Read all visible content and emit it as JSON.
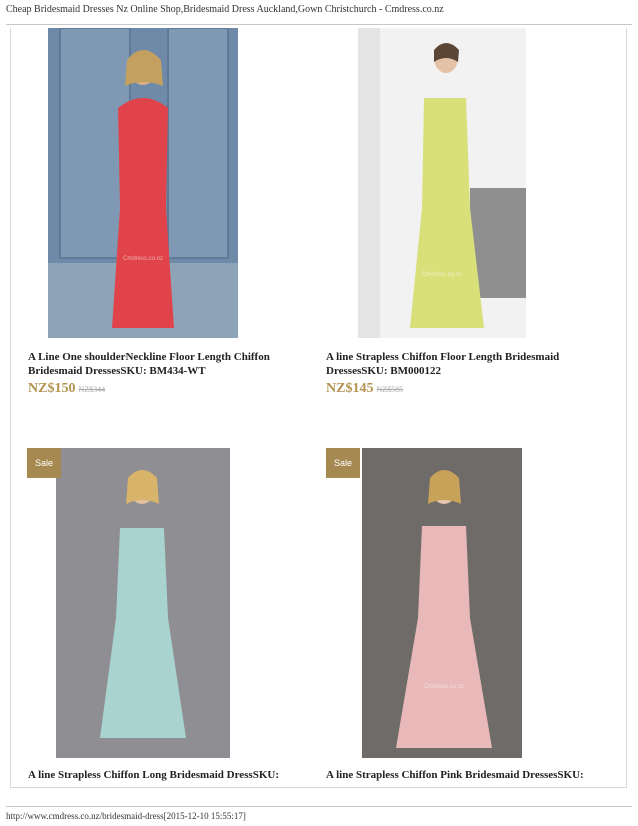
{
  "header": {
    "title": "Cheap Bridesmaid Dresses Nz Online Shop,Bridesmaid Dress Auckland,Gown Christchurch - Cmdress.co.nz"
  },
  "products": [
    {
      "title": "A Line One shoulderNeckline Floor Length Chiffon Bridesmaid DressesSKU: BM434-WT",
      "price": "NZ$150",
      "old_price": "NZ$344",
      "dress_color": "#e0444a",
      "watermark": "Cmdress.co.nz"
    },
    {
      "title": "A line Strapless Chiffon Floor Length Bridesmaid DressesSKU: BM000122",
      "price": "NZ$145",
      "old_price": "NZ$585",
      "dress_color": "#d9e07a",
      "watermark": "Cmdress.co.nz"
    },
    {
      "title": "A line Strapless Chiffon Long Bridesmaid DressSKU:",
      "sale_badge": "Sale",
      "dress_color": "#a9d3cf"
    },
    {
      "title": "A line Strapless Chiffon Pink Bridesmaid DressesSKU:",
      "sale_badge": "Sale",
      "dress_color": "#e8b9b8",
      "watermark": "Cmdress.co.nz"
    }
  ],
  "footer": {
    "url_text": "http://www.cmdress.co.nz/bridesmaid-dress[2015-12-10 15:55:17]"
  }
}
